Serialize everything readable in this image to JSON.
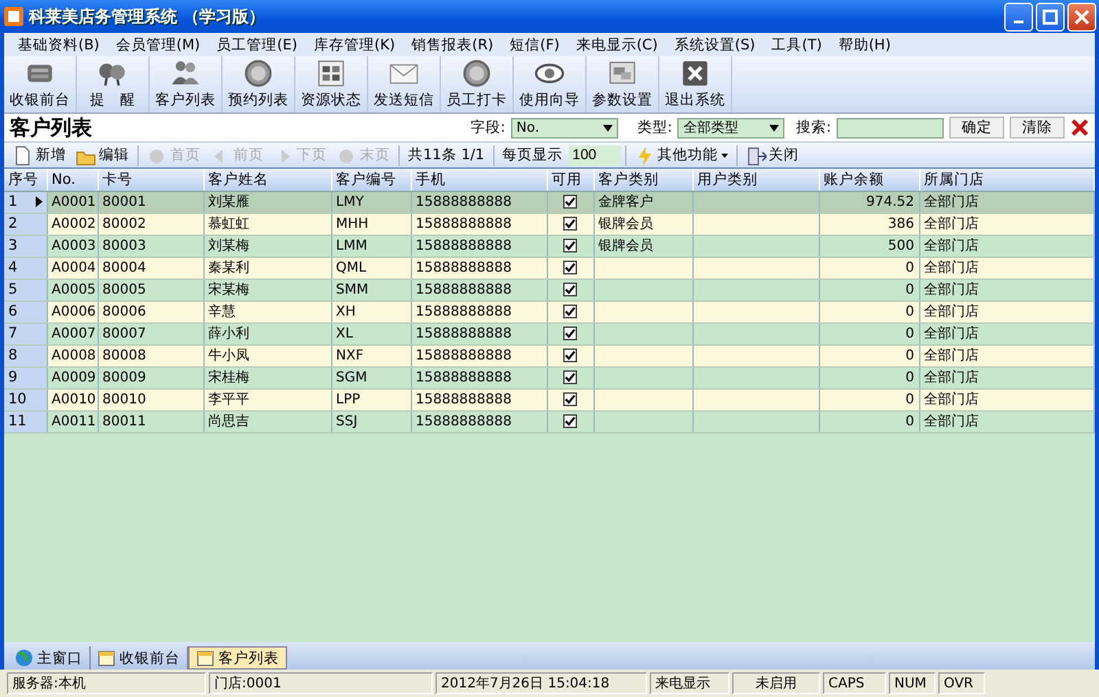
{
  "window": {
    "title": "科莱美店务管理系统 （学习版）"
  },
  "menu": [
    "基础资料(B)",
    "会员管理(M)",
    "员工管理(E)",
    "库存管理(K)",
    "销售报表(R)",
    "短信(F)",
    "来电显示(C)",
    "系统设置(S)",
    "工具(T)",
    "帮助(H)"
  ],
  "toolbar": [
    "收银前台",
    "提　醒",
    "客户列表",
    "预约列表",
    "资源状态",
    "发送短信",
    "员工打卡",
    "使用向导",
    "参数设置",
    "退出系统"
  ],
  "panel": {
    "title": "客户列表",
    "field_label": "字段:",
    "field_value": "No.",
    "type_label": "类型:",
    "type_value": "全部类型",
    "search_label": "搜索:",
    "buttons": [
      "确定",
      "清除"
    ]
  },
  "actions": [
    {
      "kind": "button",
      "label": "新增",
      "disabled": false
    },
    {
      "kind": "button",
      "label": "编辑",
      "disabled": false
    },
    {
      "kind": "button",
      "label": "首页",
      "disabled": true
    },
    {
      "kind": "button",
      "label": "前页",
      "disabled": true
    },
    {
      "kind": "button",
      "label": "下页",
      "disabled": true
    },
    {
      "kind": "button",
      "label": "末页",
      "disabled": true
    },
    {
      "kind": "text",
      "label": "共11条 1/1"
    },
    {
      "kind": "text",
      "label": "每页显示"
    },
    {
      "kind": "input",
      "value": "100"
    },
    {
      "kind": "menu",
      "label": "其他功能"
    },
    {
      "kind": "button",
      "label": "关闭",
      "disabled": false
    }
  ],
  "table": {
    "columns": [
      "序号",
      "No.",
      "卡号",
      "客户姓名",
      "客户编号",
      "手机",
      "可用",
      "客户类别",
      "用户类别",
      "账户余额",
      "所属门店"
    ],
    "rows": [
      {
        "index": "1",
        "no": "A0001",
        "card": "80001",
        "name": "刘某雁",
        "code": "LMY",
        "phone": "15888888888",
        "enabled": true,
        "customer_type": "金牌客户",
        "balance": "974.52",
        "store": "全部门店",
        "selected": true
      },
      {
        "index": "2",
        "no": "A0002",
        "card": "80002",
        "name": "慕虹虹",
        "code": "MHH",
        "phone": "15888888888",
        "enabled": true,
        "customer_type": "银牌会员",
        "balance": "386",
        "store": "全部门店",
        "selected": false
      },
      {
        "index": "3",
        "no": "A0003",
        "card": "80003",
        "name": "刘某梅",
        "code": "LMM",
        "phone": "15888888888",
        "enabled": true,
        "customer_type": "银牌会员",
        "balance": "500",
        "store": "全部门店",
        "selected": false
      },
      {
        "index": "4",
        "no": "A0004",
        "card": "80004",
        "name": "秦某利",
        "code": "QML",
        "phone": "15888888888",
        "enabled": true,
        "balance": "0",
        "store": "全部门店",
        "selected": false
      },
      {
        "index": "5",
        "no": "A0005",
        "card": "80005",
        "name": "宋某梅",
        "code": "SMM",
        "phone": "15888888888",
        "enabled": true,
        "balance": "0",
        "store": "全部门店",
        "selected": false
      },
      {
        "index": "6",
        "no": "A0006",
        "card": "80006",
        "name": "辛慧",
        "code": "XH",
        "phone": "15888888888",
        "enabled": true,
        "balance": "0",
        "store": "全部门店",
        "selected": false
      },
      {
        "index": "7",
        "no": "A0007",
        "card": "80007",
        "name": "薛小利",
        "code": "XL",
        "phone": "15888888888",
        "enabled": true,
        "balance": "0",
        "store": "全部门店",
        "selected": false
      },
      {
        "index": "8",
        "no": "A0008",
        "card": "80008",
        "name": "牛小凤",
        "code": "NXF",
        "phone": "15888888888",
        "enabled": true,
        "balance": "0",
        "store": "全部门店",
        "selected": false
      },
      {
        "index": "9",
        "no": "A0009",
        "card": "80009",
        "name": "宋桂梅",
        "code": "SGM",
        "phone": "15888888888",
        "enabled": true,
        "balance": "0",
        "store": "全部门店",
        "selected": false
      },
      {
        "index": "10",
        "no": "A0010",
        "card": "80010",
        "name": "李平平",
        "code": "LPP",
        "phone": "15888888888",
        "enabled": true,
        "balance": "0",
        "store": "全部门店",
        "selected": false
      },
      {
        "index": "11",
        "no": "A0011",
        "card": "80011",
        "name": "尚思吉",
        "code": "SSJ",
        "phone": "15888888888",
        "enabled": true,
        "balance": "0",
        "store": "全部门店",
        "selected": false
      }
    ]
  },
  "tabs": [
    {
      "label": "主窗口",
      "selected": false
    },
    {
      "label": "收银前台",
      "selected": false
    },
    {
      "label": "客户列表",
      "selected": true
    }
  ],
  "status_bar": [
    "服务器:本机",
    "门店:0001",
    "2012年7月26日 15:04:18",
    "来电显示",
    "未启用",
    "CAPS",
    "NUM",
    "OVR"
  ]
}
